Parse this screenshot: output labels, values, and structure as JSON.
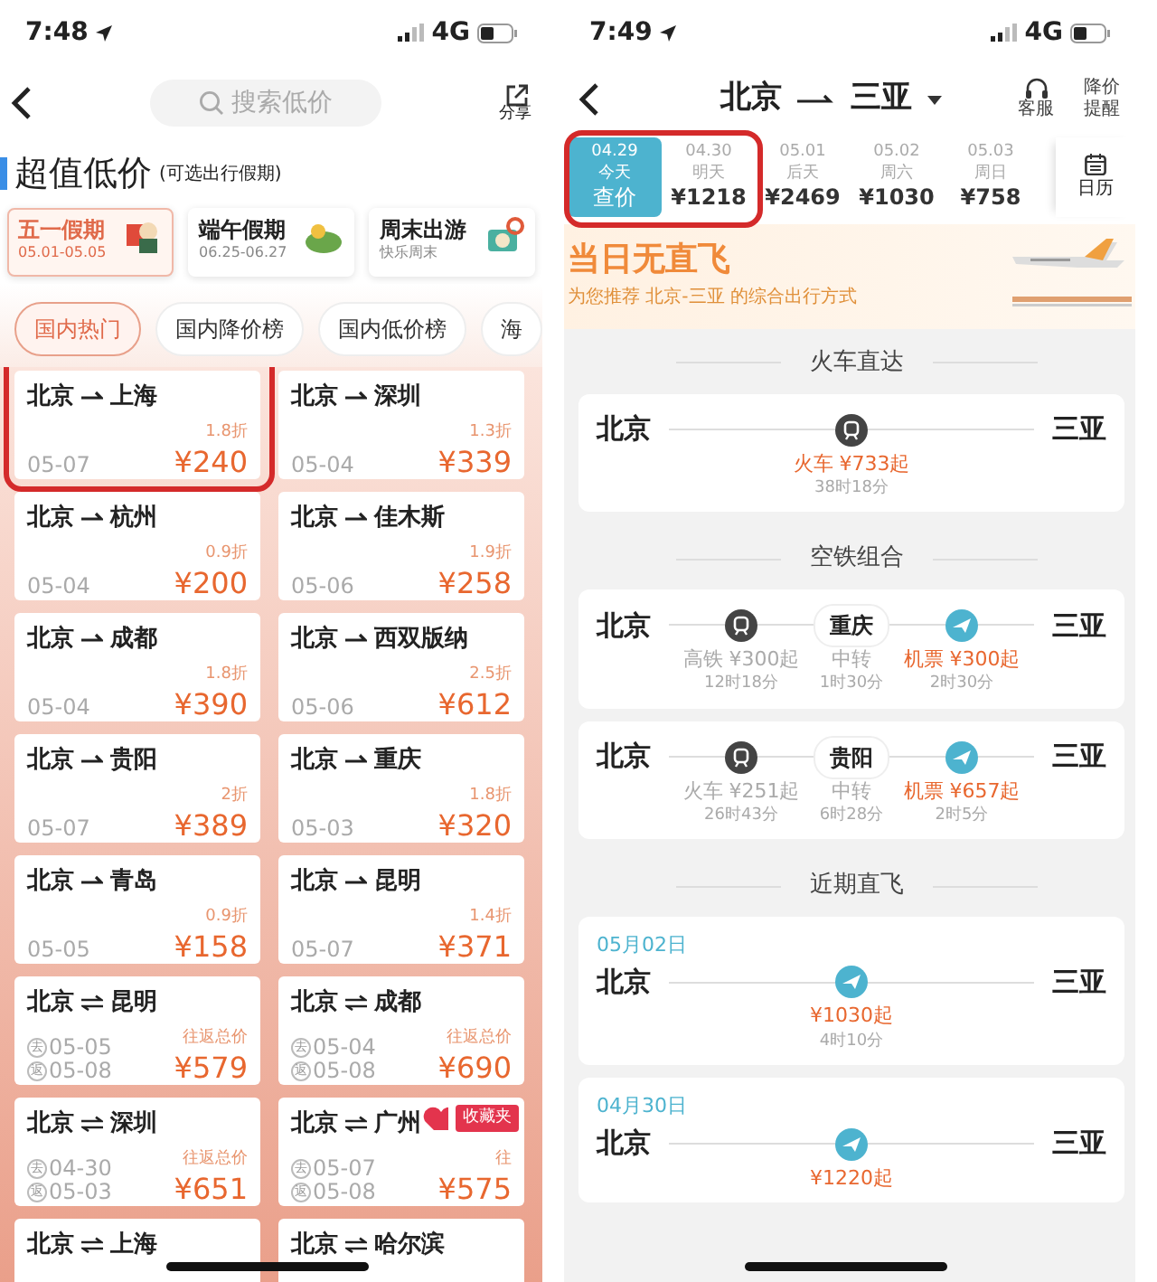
{
  "left_screen": {
    "status_bar": {
      "time": "7:48",
      "network": "4G"
    },
    "header": {
      "search_placeholder": "搜索低价",
      "share_label": "分享"
    },
    "section": {
      "title": "超值低价",
      "subtitle": "(可选出行假期)"
    },
    "holidays": [
      {
        "title": "五一假期",
        "subtitle": "05.01-05.05",
        "selected": true
      },
      {
        "title": "端午假期",
        "subtitle": "06.25-06.27",
        "selected": false
      },
      {
        "title": "周末出游",
        "subtitle": "快乐周末",
        "selected": false
      }
    ],
    "filter_tabs": [
      {
        "label": "国内热门",
        "selected": true
      },
      {
        "label": "国内降价榜",
        "selected": false
      },
      {
        "label": "国内低价榜",
        "selected": false
      },
      {
        "label": "海",
        "selected": false
      }
    ],
    "highlight_box": true,
    "routes": [
      {
        "from": "北京",
        "to": "上海",
        "kind": "one_way",
        "date": "05-07",
        "discount": "1.8折",
        "price": "¥240"
      },
      {
        "from": "北京",
        "to": "深圳",
        "kind": "one_way",
        "date": "05-04",
        "discount": "1.3折",
        "price": "¥339"
      },
      {
        "from": "北京",
        "to": "杭州",
        "kind": "one_way",
        "date": "05-04",
        "discount": "0.9折",
        "price": "¥200"
      },
      {
        "from": "北京",
        "to": "佳木斯",
        "kind": "one_way",
        "date": "05-06",
        "discount": "1.9折",
        "price": "¥258"
      },
      {
        "from": "北京",
        "to": "成都",
        "kind": "one_way",
        "date": "05-04",
        "discount": "1.8折",
        "price": "¥390"
      },
      {
        "from": "北京",
        "to": "西双版纳",
        "kind": "one_way",
        "date": "05-06",
        "discount": "2.5折",
        "price": "¥612"
      },
      {
        "from": "北京",
        "to": "贵阳",
        "kind": "one_way",
        "date": "05-07",
        "discount": "2折",
        "price": "¥389"
      },
      {
        "from": "北京",
        "to": "重庆",
        "kind": "one_way",
        "date": "05-03",
        "discount": "1.8折",
        "price": "¥320"
      },
      {
        "from": "北京",
        "to": "青岛",
        "kind": "one_way",
        "date": "05-05",
        "discount": "0.9折",
        "price": "¥158"
      },
      {
        "from": "北京",
        "to": "昆明",
        "kind": "one_way",
        "date": "05-07",
        "discount": "1.4折",
        "price": "¥371"
      },
      {
        "from": "北京",
        "to": "昆明",
        "kind": "round_trip",
        "dates": [
          {
            "mark": "去",
            "date": "05-05"
          },
          {
            "mark": "返",
            "date": "05-08"
          }
        ],
        "price_label": "往返总价",
        "price": "¥579"
      },
      {
        "from": "北京",
        "to": "成都",
        "kind": "round_trip",
        "dates": [
          {
            "mark": "去",
            "date": "05-04"
          },
          {
            "mark": "返",
            "date": "05-08"
          }
        ],
        "price_label": "往返总价",
        "price": "¥690"
      },
      {
        "from": "北京",
        "to": "深圳",
        "kind": "round_trip",
        "dates": [
          {
            "mark": "去",
            "date": "04-30"
          },
          {
            "mark": "返",
            "date": "05-03"
          }
        ],
        "price_label": "往返总价",
        "price": "¥651"
      },
      {
        "from": "北京",
        "to": "广州",
        "kind": "round_trip",
        "dates": [
          {
            "mark": "去",
            "date": "05-07"
          },
          {
            "mark": "返",
            "date": "05-08"
          }
        ],
        "price_label": "往",
        "price": "¥575",
        "badge": "收藏夹"
      },
      {
        "from": "北京",
        "to": "上海",
        "kind": "round_trip"
      },
      {
        "from": "北京",
        "to": "哈尔滨",
        "kind": "round_trip"
      }
    ]
  },
  "right_screen": {
    "status_bar": {
      "time": "7:49",
      "network": "4G"
    },
    "header": {
      "from": "北京",
      "to": "三亚",
      "service_label": "客服",
      "alert_label": "降价提醒"
    },
    "date_tabs": [
      {
        "date": "04.29",
        "day": "今天",
        "price": "查价",
        "selected": true
      },
      {
        "date": "04.30",
        "day": "明天",
        "price": "¥1218",
        "selected": false
      },
      {
        "date": "05.01",
        "day": "后天",
        "price": "¥2469",
        "selected": false
      },
      {
        "date": "05.02",
        "day": "周六",
        "price": "¥1030",
        "selected": false
      },
      {
        "date": "05.03",
        "day": "周日",
        "price": "¥758",
        "selected": false
      }
    ],
    "calendar_label": "日历",
    "highlight_box": true,
    "banner": {
      "title": "当日无直飞",
      "subtitle": "为您推荐 北京-三亚 的综合出行方式"
    },
    "sections": [
      {
        "title": "火车直达",
        "cards": [
          {
            "kind": "direct",
            "from": "北京",
            "to": "三亚",
            "leg": {
              "kind": "train"
            },
            "price": "火车 ¥733起",
            "duration": "38时18分"
          }
        ]
      },
      {
        "title": "空铁组合",
        "cards": [
          {
            "kind": "transfer",
            "from": "北京",
            "to": "三亚",
            "legs": [
              {
                "kind": "train",
                "price": "高铁 ¥300起",
                "duration": "12时18分"
              },
              {
                "kind": "plane",
                "price": "机票 ¥300起",
                "duration": "2时30分"
              }
            ],
            "transfer": {
              "city": "重庆",
              "label": "中转",
              "duration": "1时30分"
            }
          },
          {
            "kind": "transfer",
            "from": "北京",
            "to": "三亚",
            "legs": [
              {
                "kind": "train",
                "price": "火车 ¥251起",
                "duration": "26时43分"
              },
              {
                "kind": "plane",
                "price": "机票 ¥657起",
                "duration": "2时5分"
              }
            ],
            "transfer": {
              "city": "贵阳",
              "label": "中转",
              "duration": "6时28分"
            }
          }
        ]
      },
      {
        "title": "近期直飞",
        "cards": [
          {
            "kind": "direct",
            "date": "05月02日",
            "from": "北京",
            "to": "三亚",
            "leg": {
              "kind": "plane"
            },
            "price": "¥1030起",
            "duration": "4时10分"
          },
          {
            "kind": "direct",
            "date": "04月30日",
            "from": "北京",
            "to": "三亚",
            "leg": {
              "kind": "plane"
            },
            "price": "¥1220起"
          }
        ]
      }
    ]
  }
}
